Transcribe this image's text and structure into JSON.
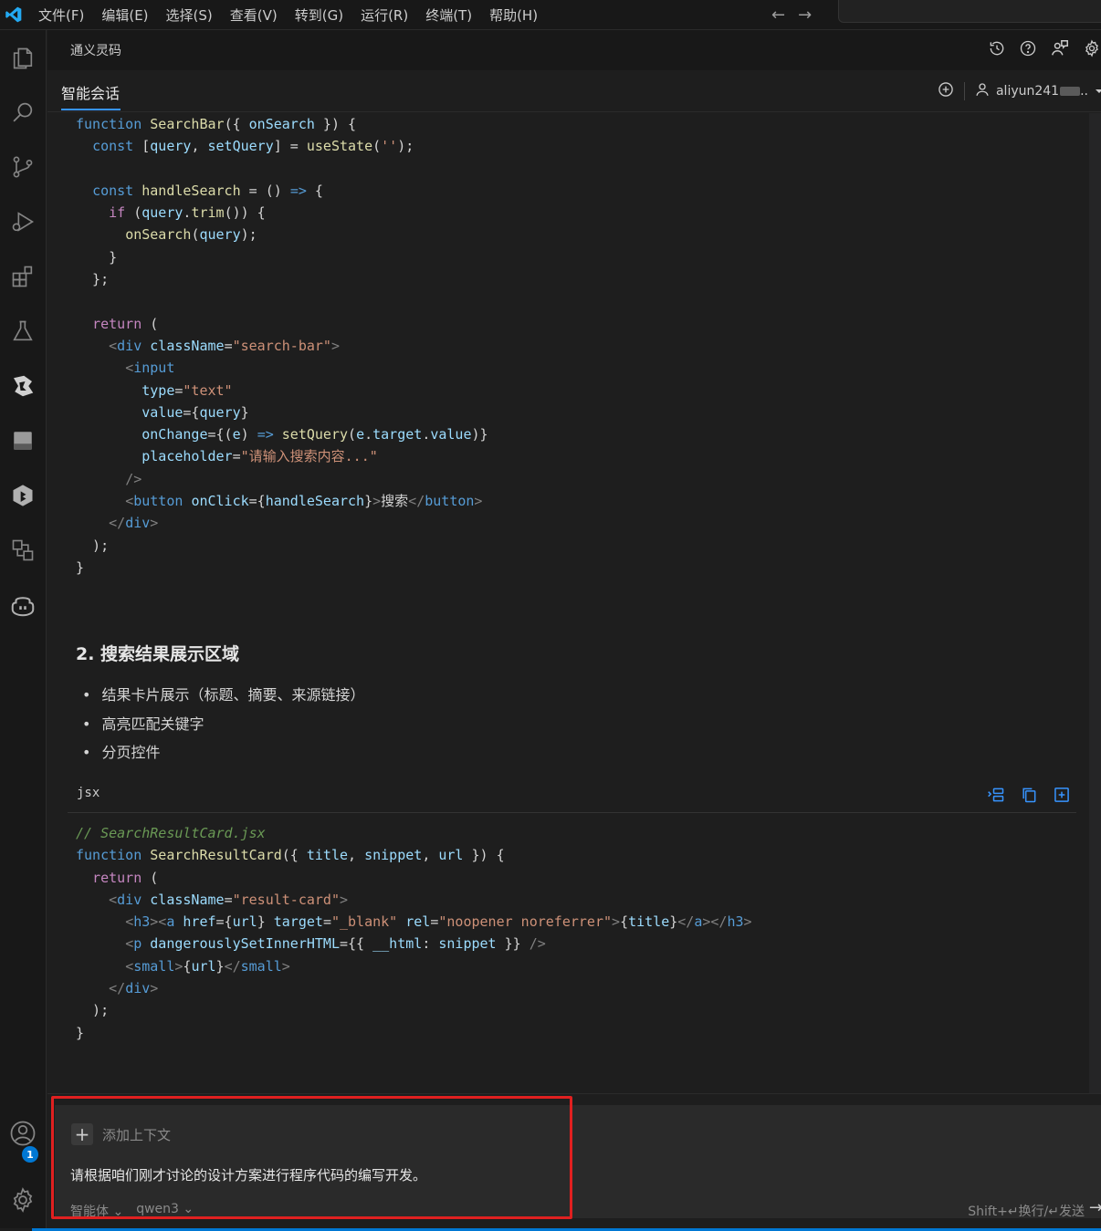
{
  "menu": [
    "文件(F)",
    "编辑(E)",
    "选择(S)",
    "查看(V)",
    "转到(G)",
    "运行(R)",
    "终端(T)",
    "帮助(H)"
  ],
  "panel": {
    "title": "通义灵码"
  },
  "tabs": {
    "active": "智能会话"
  },
  "user": {
    "name": "aliyun241",
    "suffix": ".."
  },
  "badge": {
    "count": "1"
  },
  "section": {
    "title": "2. 搜索结果展示区域",
    "bullets": [
      "结果卡片展示（标题、摘要、来源链接）",
      "高亮匹配关键字",
      "分页控件"
    ]
  },
  "codeblock": {
    "language": "jsx"
  },
  "input": {
    "add_context": "添加上下文",
    "prompt": "请根据咱们刚才讨论的设计方案进行程序代码的编写开发。",
    "mode": "智能体",
    "model": "qwen3",
    "send_hint": "Shift+↵换行/↵发送"
  },
  "colors": {
    "accent": "#3794ff",
    "highlight_frame": "#e02020",
    "badge": "#0078d4"
  },
  "icons": [
    "explorer-icon",
    "search-icon",
    "source-control-icon",
    "run-debug-icon",
    "extensions-icon",
    "testing-icon",
    "lingma-icon",
    "panel-icon",
    "plugin-icon",
    "remote-icon",
    "copilot-icon",
    "account-icon",
    "settings-icon"
  ]
}
